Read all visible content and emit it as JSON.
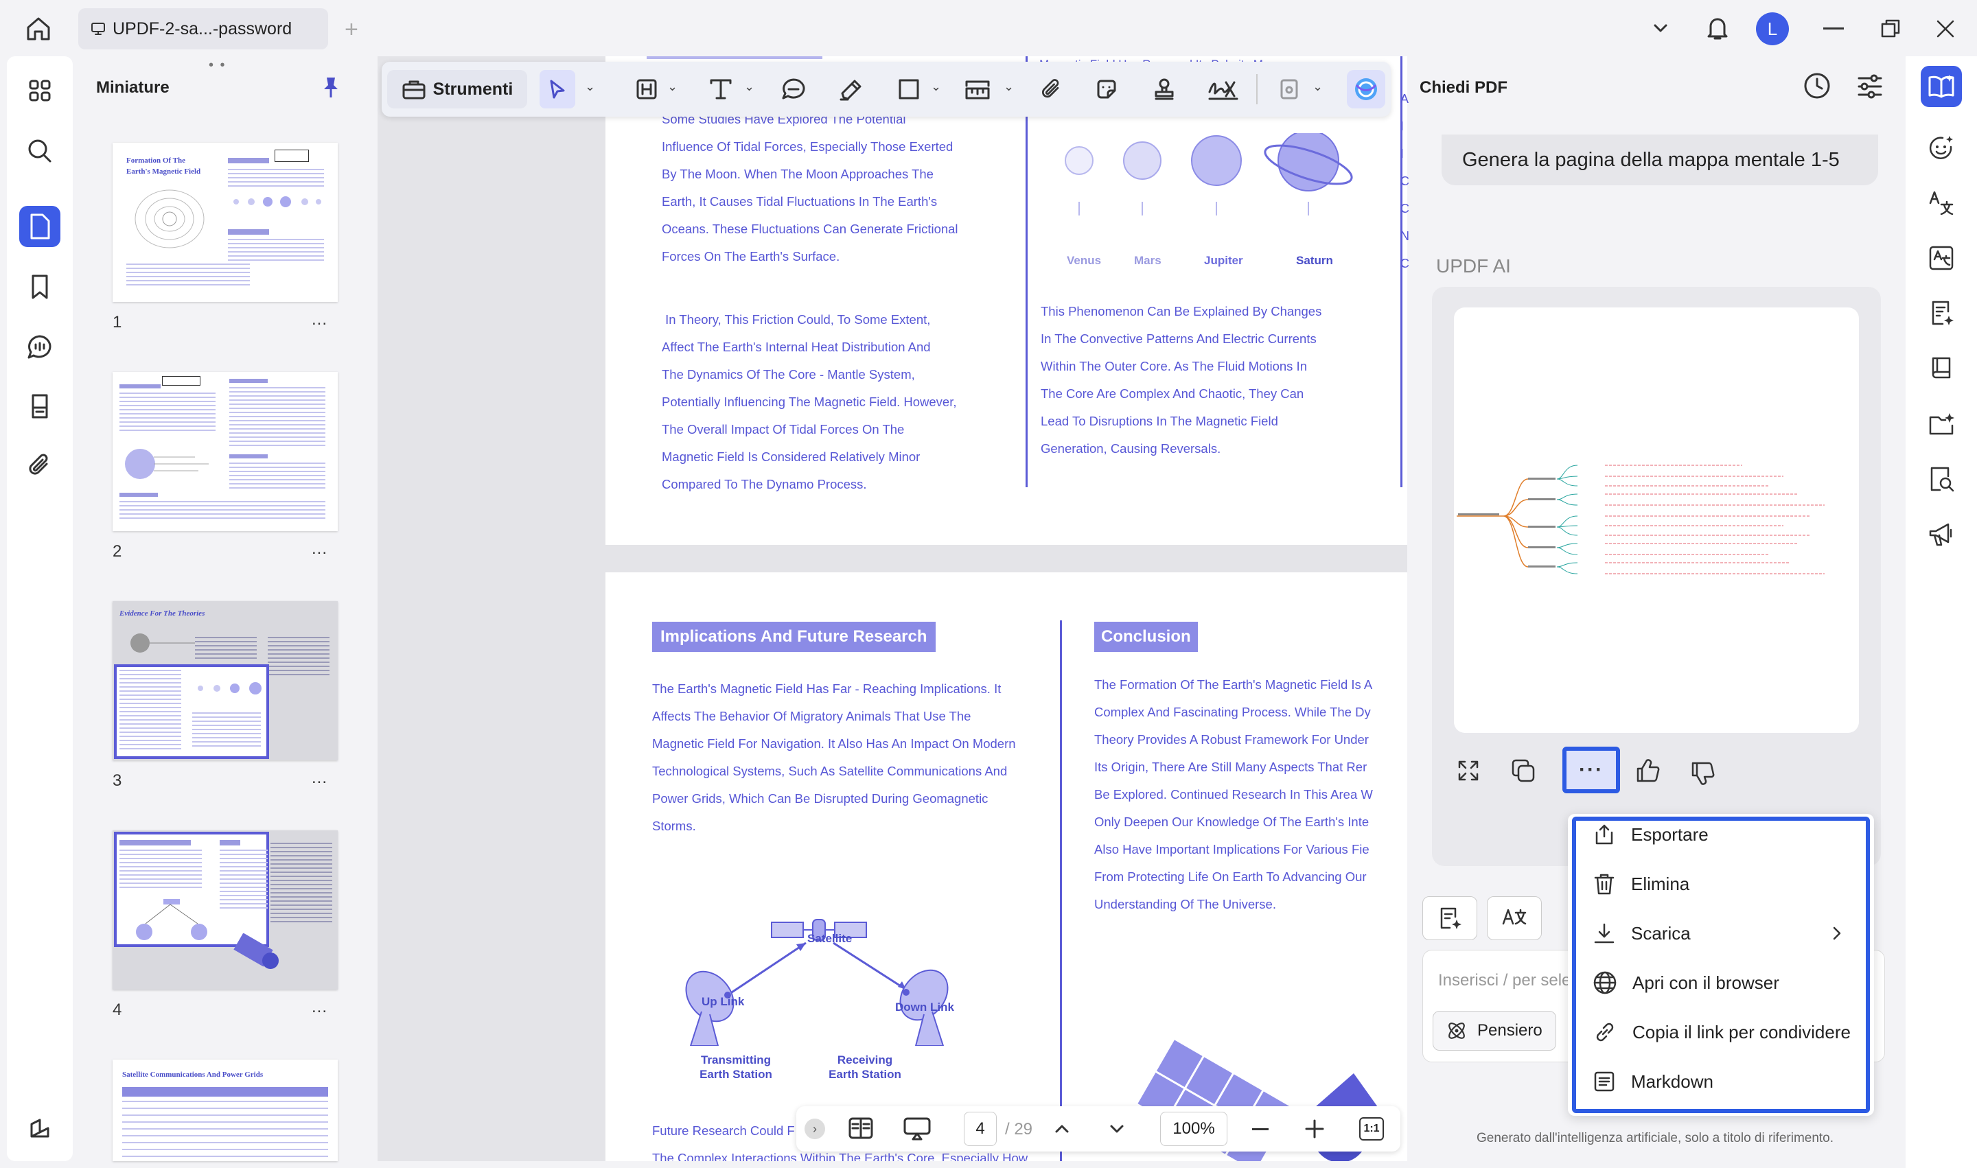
{
  "tab": {
    "title": "UPDF-2-sa...-password"
  },
  "user": {
    "avatar_letter": "L"
  },
  "colors": {
    "accent": "#5b5bd6",
    "brand_blue": "#2d5be3",
    "doc_text": "#5757d6"
  },
  "thumbnails": {
    "title": "Miniature",
    "pages": [
      {
        "number": "1",
        "more": "...",
        "heading": "Formation Of The Earth's Magnetic Field"
      },
      {
        "number": "2",
        "more": "..."
      },
      {
        "number": "3",
        "more": "...",
        "heading": "Evidence For The Theories"
      },
      {
        "number": "4",
        "more": "..."
      },
      {
        "heading": "Satellite Communications And Power Grids"
      }
    ]
  },
  "toolbar": {
    "tools_label": "Strumenti"
  },
  "document": {
    "page_a_left": [
      "Some Studies Have Explored The Potential",
      "Influence Of Tidal Forces, Especially Those Exerted",
      "By The Moon. When The Moon Approaches The",
      "Earth, It Causes Tidal Fluctuations In The Earth's",
      "Oceans. These Fluctuations Can Generate Frictional",
      "Forces On The Earth's Surface."
    ],
    "page_a_left2": [
      " In Theory, This Friction Could, To Some Extent,",
      "Affect The Earth's Internal Heat Distribution And",
      "The Dynamics Of The Core - Mantle System,",
      "Potentially Influencing The Magnetic Field. However,",
      "The Overall Impact Of Tidal Forces On The",
      "Magnetic Field Is Considered Relatively Minor",
      "Compared To The Dynamo Process."
    ],
    "page_a_right_top": "Magnetic Field Has Reversed Its Polarity Many",
    "planets": [
      "Venus",
      "Mars",
      "Jupiter",
      "Saturn"
    ],
    "page_a_right": [
      "This Phenomenon Can Be Explained By Changes",
      "In The Convective Patterns And Electric Currents",
      "Within The Outer Core. As The Fluid Motions In",
      "The Core Are Complex And Chaotic, They Can",
      "Lead To Disruptions In The Magnetic Field",
      "Generation, Causing Reversals."
    ],
    "page_b_heading_left": "Implications And Future Research",
    "page_b_left": [
      "The Earth's Magnetic Field Has Far - Reaching Implications. It",
      "Affects The Behavior Of Migratory Animals That Use The",
      "Magnetic Field For Navigation. It Also Has An Impact On Modern",
      "Technological Systems, Such As Satellite Communications And",
      "Power Grids, Which Can Be Disrupted During Geomagnetic",
      "Storms."
    ],
    "diagram": {
      "satellite": "Satellite",
      "up_link": "Up Link",
      "down_link": "Down Link",
      "tx1": "Transmitting",
      "tx2": "Earth Station",
      "rx1": "Receiving",
      "rx2": "Earth Station"
    },
    "page_b_left_bottom1": "Future Research Could F",
    "page_b_left_bottom2": "The Complex Interactions Within The Earth's Core, Especially How",
    "page_b_heading_right": "Conclusion",
    "page_b_right": [
      "The Formation Of The Earth's Magnetic Field Is A",
      "Complex And Fascinating Process. While The Dy",
      "Theory Provides A Robust Framework For Under",
      "Its Origin, There Are Still Many Aspects That Rer",
      "Be Explored. Continued Research In This Area W",
      "Only Deepen Our Knowledge Of The Earth's Inte",
      "Also Have Important Implications For Various Fie",
      "From Protecting Life On Earth To Advancing Our",
      "Understanding Of The Universe."
    ]
  },
  "pager": {
    "current": "4",
    "total": "/ 29",
    "zoom": "100%"
  },
  "chat": {
    "title": "Chiedi PDF",
    "user_message": "Genera la pagina della mappa mentale 1-5",
    "ai_label": "UPDF AI",
    "input_placeholder": "Inserisci / per selez",
    "thinking_button": "Pensiero",
    "disclaimer": "Generato dall'intelligenza artificiale, solo a titolo di riferimento."
  },
  "menu": {
    "items": [
      "Esportare",
      "Elimina",
      "Scarica",
      "Apri con il browser",
      "Copia il link per condividere",
      "Markdown"
    ]
  },
  "right_edge_letters": [
    "A",
    "I",
    "I",
    "C",
    "C",
    "N",
    "C"
  ]
}
